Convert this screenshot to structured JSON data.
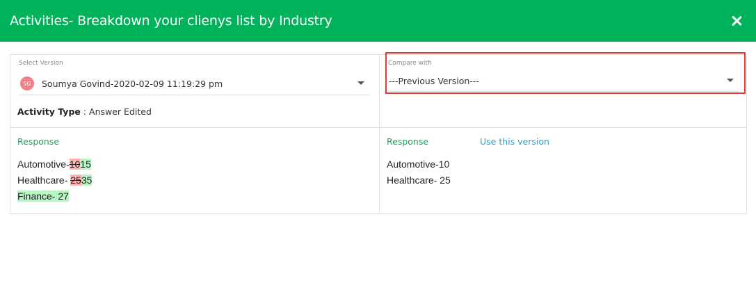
{
  "header": {
    "title": "Activities- Breakdown your clienys list by Industry"
  },
  "left": {
    "select_label": "Select Version",
    "avatar_initials": "SG",
    "selected_version": "Soumya Govind-2020-02-09 11:19:29 pm",
    "activity_type_label": "Activity Type",
    "activity_type_value": " : Answer Edited",
    "response_label": "Response",
    "lines": [
      {
        "prefix": "Automotive-",
        "deleted": "10",
        "inserted": "15"
      },
      {
        "prefix": "Healthcare- ",
        "deleted": "25",
        "inserted": "35"
      },
      {
        "inserted_full": "Finance- 27"
      }
    ]
  },
  "right": {
    "compare_label": "Compare with",
    "compare_value": "---Previous Version---",
    "response_label": "Response",
    "use_version_label": "Use this version",
    "lines": [
      "Automotive-10",
      "Healthcare- 25"
    ]
  },
  "colors": {
    "header": "#00b259",
    "highlight_border": "#e53935",
    "deleted_bg": "#ffb3b3",
    "inserted_bg": "#b7f5c2",
    "link": "#2a9fd6"
  },
  "icons": {
    "close": "close-icon",
    "dropdown": "chevron-down-icon"
  }
}
